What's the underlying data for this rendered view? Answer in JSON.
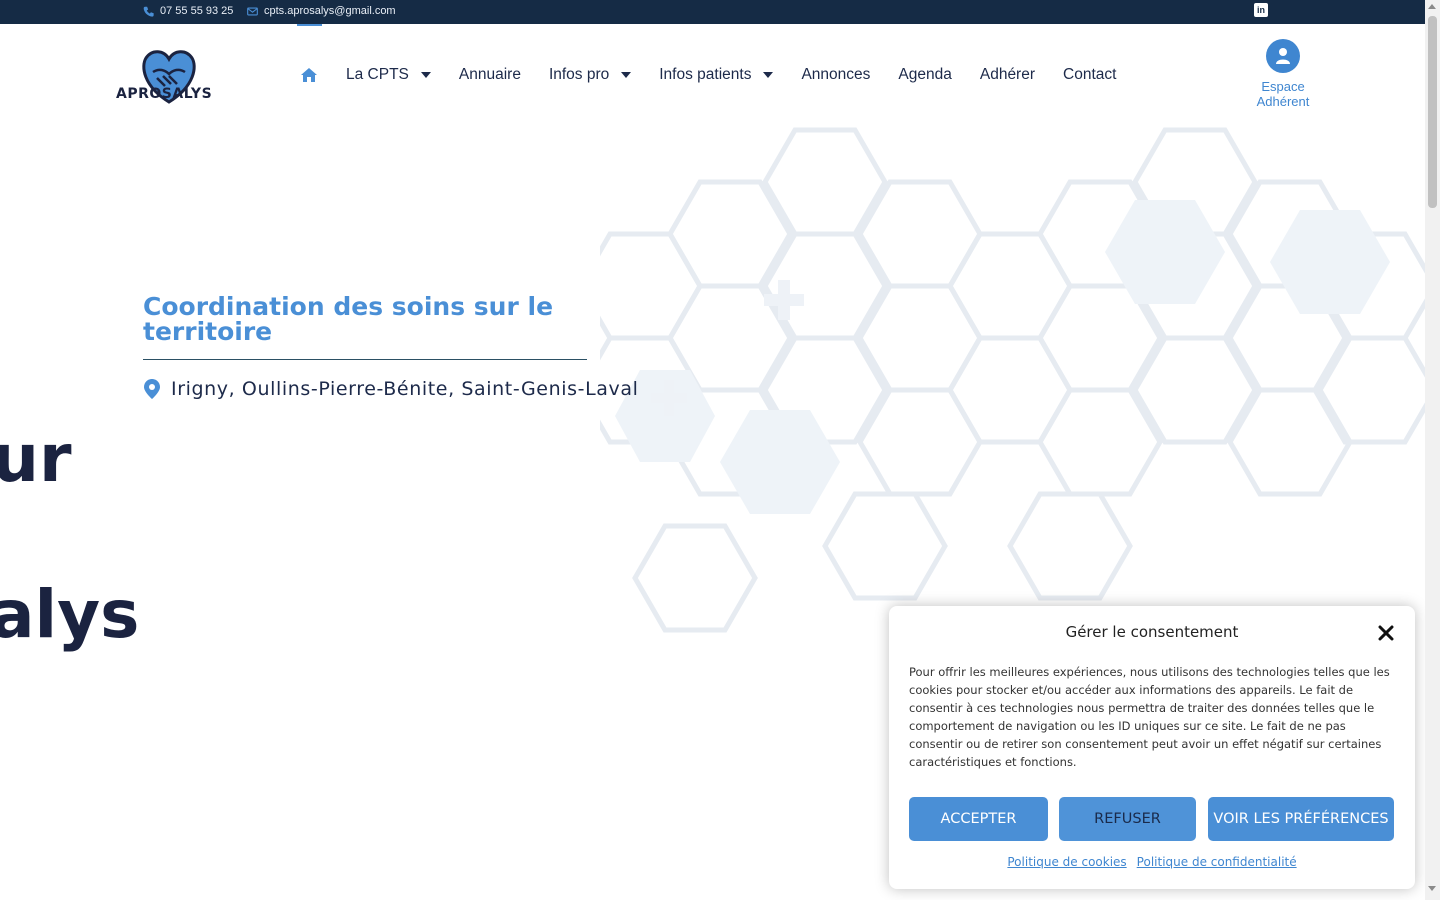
{
  "topbar": {
    "phone": "07 55 55 93 25",
    "email": "cpts.aprosalys@gmail.com",
    "social": "in"
  },
  "brand": {
    "name": "APROSALYS"
  },
  "nav": {
    "items": [
      {
        "label": "La CPTS"
      },
      {
        "label": "Annuaire"
      },
      {
        "label": "Infos pro"
      },
      {
        "label": "Infos patients"
      },
      {
        "label": "Annonces"
      },
      {
        "label": "Agenda"
      },
      {
        "label": "Adhérer"
      },
      {
        "label": "Contact"
      }
    ],
    "espace_line1": "Espace",
    "espace_line2": "Adhérent"
  },
  "hero": {
    "title": "Coordination des soins sur le territoire",
    "location": "Irigny, Oullins-Pierre-Bénite, Saint-Genis-Laval",
    "big_word_1": "ur",
    "big_word_2": "alys"
  },
  "consent": {
    "title": "Gérer le consentement",
    "text": "Pour offrir les meilleures expériences, nous utilisons des technologies telles que les cookies pour stocker et/ou accéder aux informations des appareils. Le fait de consentir à ces technologies nous permettra de traiter des données telles que le comportement de navigation ou les ID uniques sur ce site. Le fait de ne pas consentir ou de retirer son consentement peut avoir un effet négatif sur certaines caractéristiques et fonctions.",
    "accept": "ACCEPTER",
    "refuse": "REFUSER",
    "preferences": "VOIR LES PRÉFÉRENCES",
    "link_cookies": "Politique de cookies",
    "link_privacy": "Politique de confidentialité"
  },
  "colors": {
    "topbar": "#152b45",
    "accent": "#4a8fd6",
    "text": "#1d2a4a"
  }
}
